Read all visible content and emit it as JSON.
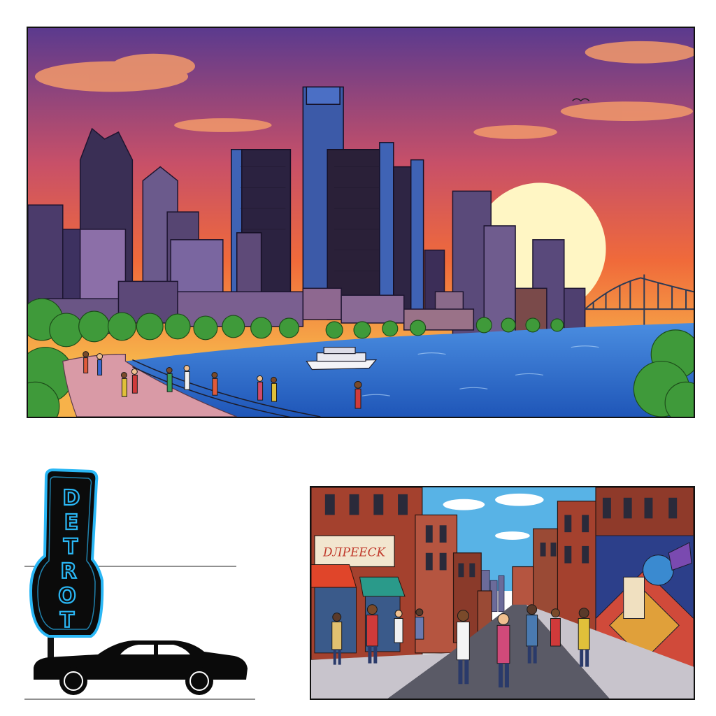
{
  "sign": {
    "letters": [
      "D",
      "E",
      "T",
      "R",
      "O",
      "T"
    ],
    "neon_color": "#2ab7f5"
  },
  "storefront": {
    "text": "DЛPEЕCK"
  },
  "colors": {
    "sky_top": "#5b3a8e",
    "sky_mid": "#f06a3a",
    "sky_low": "#f7b24a",
    "sun": "#fff6c4",
    "river": "#2f6fd0",
    "trees": "#3f9a3a",
    "brick": "#a4412e",
    "street_sky": "#58b3e6"
  }
}
